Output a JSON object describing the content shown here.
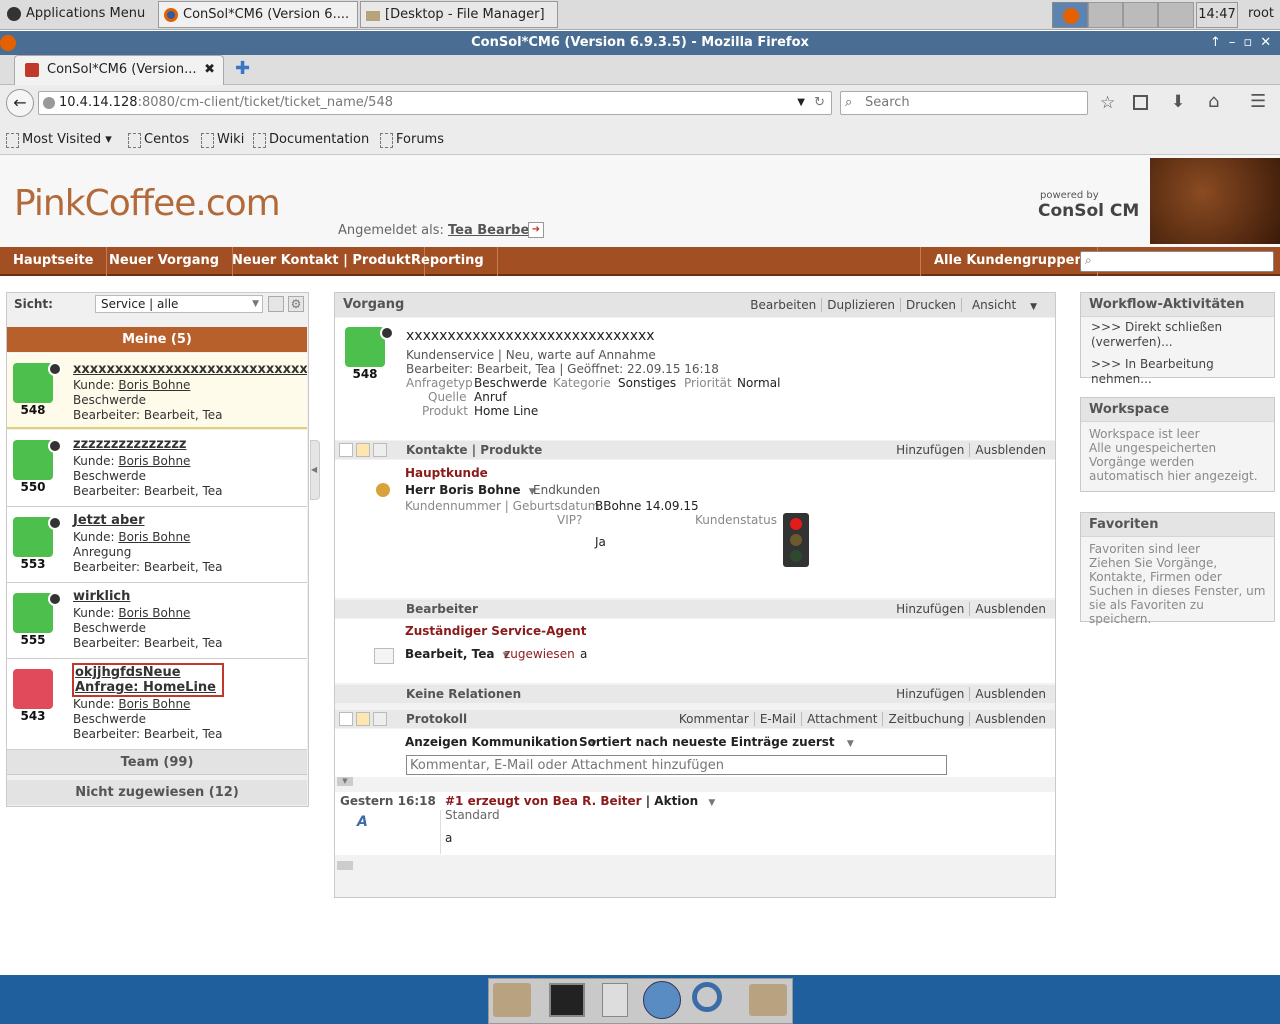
{
  "taskbar": {
    "apps_menu": "Applications Menu",
    "task1": "ConSol*CM6 (Version 6....",
    "task2": "[Desktop - File Manager]",
    "clock": "14:47",
    "user": "root"
  },
  "window": {
    "title": "ConSol*CM6 (Version 6.9.3.5) - Mozilla Firefox"
  },
  "browser": {
    "tab_label": "ConSol*CM6 (Version...",
    "url_host": "10.4.14.128",
    "url_path": ":8080/cm-client/ticket/ticket_name/548",
    "search_placeholder": "Search",
    "bookmarks": [
      "Most Visited",
      "Centos",
      "Wiki",
      "Documentation",
      "Forums"
    ]
  },
  "app": {
    "logo": "PinkCoffee.com",
    "powered_by": "powered by",
    "brand": "ConSol CM",
    "logged_in_label": "Angemeldet als:",
    "logged_in_user": "Tea Bearbeit",
    "menu": [
      "Hauptseite",
      "Neuer Vorgang",
      "Neuer Kontakt | Produkt",
      "Reporting"
    ],
    "menu_right": "Alle Kundengruppen"
  },
  "left": {
    "view_label": "Sicht:",
    "view_value": "Service | alle",
    "mine_header": "Meine (5)",
    "tickets": [
      {
        "num": "548",
        "title": "xxxxxxxxxxxxxxxxxxxxxxxxxxxxxx",
        "customer_label": "Kunde:",
        "customer": "Boris Bohne",
        "category": "Beschwerde",
        "editor": "Bearbeiter: Bearbeit, Tea"
      },
      {
        "num": "550",
        "title": "zzzzzzzzzzzzzzz",
        "customer_label": "Kunde:",
        "customer": "Boris Bohne",
        "category": "Beschwerde",
        "editor": "Bearbeiter: Bearbeit, Tea"
      },
      {
        "num": "553",
        "title": "Jetzt aber",
        "customer_label": "Kunde:",
        "customer": "Boris Bohne",
        "category": "Anregung",
        "editor": "Bearbeiter: Bearbeit, Tea"
      },
      {
        "num": "555",
        "title": "wirklich",
        "customer_label": "Kunde:",
        "customer": "Boris Bohne",
        "category": "Beschwerde",
        "editor": "Bearbeiter: Bearbeit, Tea"
      },
      {
        "num": "543",
        "title": "okjjhgfdsNeue Anfrage: HomeLine",
        "customer_label": "Kunde:",
        "customer": "Boris Bohne",
        "category": "Beschwerde",
        "editor": "Bearbeiter: Bearbeit, Tea"
      }
    ],
    "team": "Team (99)",
    "unassigned": "Nicht zugewiesen (12)"
  },
  "vorgang": {
    "header": "Vorgang",
    "actions": [
      "Bearbeiten",
      "Duplizieren",
      "Drucken",
      "Ansicht"
    ],
    "num": "548",
    "title": "xxxxxxxxxxxxxxxxxxxxxxxxxxxxxx",
    "status": "Kundenservice | Neu, warte auf Annahme",
    "meta": "Bearbeiter: Bearbeit, Tea | Geöffnet: 22.09.15 16:18",
    "fields": {
      "anfragetyp_l": "Anfragetyp",
      "anfragetyp": "Beschwerde",
      "kategorie_l": "Kategorie",
      "kategorie": "Sonstiges",
      "prio_l": "Priorität",
      "prio": "Normal",
      "quelle_l": "Quelle",
      "quelle": "Anruf",
      "produkt_l": "Produkt",
      "produkt": "Home Line"
    }
  },
  "kontakte": {
    "header": "Kontakte | Produkte",
    "actions": [
      "Hinzufügen",
      "Ausblenden"
    ],
    "role": "Hauptkunde",
    "name": "Herr Boris Bohne",
    "type": "Endkunden",
    "kn_label": "Kundennummer | Geburtsdatum",
    "kn_value": "BBohne 14.09.15",
    "vip_label": "VIP?",
    "vip_value": "Ja",
    "status_label": "Kundenstatus"
  },
  "bearbeiter": {
    "header": "Bearbeiter",
    "actions": [
      "Hinzufügen",
      "Ausblenden"
    ],
    "role": "Zuständiger Service-Agent",
    "name": "Bearbeit, Tea",
    "assigned": "zugewiesen",
    "extra": "a"
  },
  "relationen": {
    "header": "Keine Relationen",
    "actions": [
      "Hinzufügen",
      "Ausblenden"
    ]
  },
  "protokoll": {
    "header": "Protokoll",
    "actions": [
      "Kommentar",
      "E-Mail",
      "Attachment",
      "Zeitbuchung",
      "Ausblenden"
    ],
    "filter": "Anzeigen Kommunikation",
    "sort": "Sortiert nach neueste Einträge zuerst",
    "input_placeholder": "Kommentar, E-Mail oder Attachment hinzufügen",
    "entry": {
      "time": "Gestern 16:18",
      "title": "#1 erzeugt von Bea R. Beiter",
      "action": "Aktion",
      "sub": "Standard",
      "body": "a"
    }
  },
  "right": {
    "wf_header": "Workflow-Aktivitäten",
    "wf_items": [
      ">>> Direkt schließen (verwerfen)...",
      ">>> In Bearbeitung nehmen..."
    ],
    "ws_header": "Workspace",
    "ws_text": "Workspace ist leer",
    "ws_sub": "Alle ungespeicherten Vorgänge werden automatisch hier angezeigt.",
    "fav_header": "Favoriten",
    "fav_text": "Favoriten sind leer",
    "fav_sub": "Ziehen Sie Vorgänge, Kontakte, Firmen oder Suchen in dieses Fenster, um sie als Favoriten zu speichern."
  }
}
